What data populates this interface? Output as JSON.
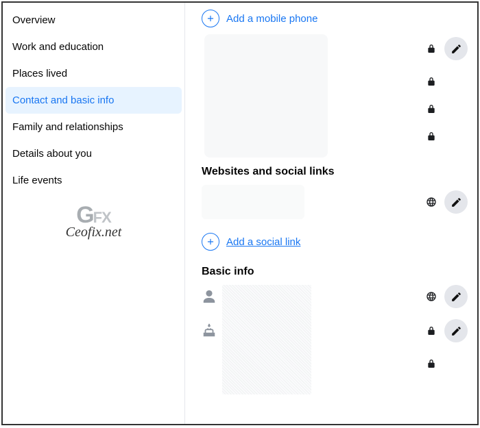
{
  "sidebar": {
    "items": [
      {
        "label": "Overview"
      },
      {
        "label": "Work and education"
      },
      {
        "label": "Places lived"
      },
      {
        "label": "Contact and basic info"
      },
      {
        "label": "Family and relationships"
      },
      {
        "label": "Details about you"
      },
      {
        "label": "Life events"
      }
    ],
    "active_index": 3
  },
  "logo": {
    "line1_a": "G",
    "line1_b": "FX",
    "line2": "Ceofix.net"
  },
  "main": {
    "add_phone_label": "Add a mobile phone",
    "section_websites_title": "Websites and social links",
    "add_social_label": "Add a social link",
    "section_basic_title": "Basic info"
  }
}
